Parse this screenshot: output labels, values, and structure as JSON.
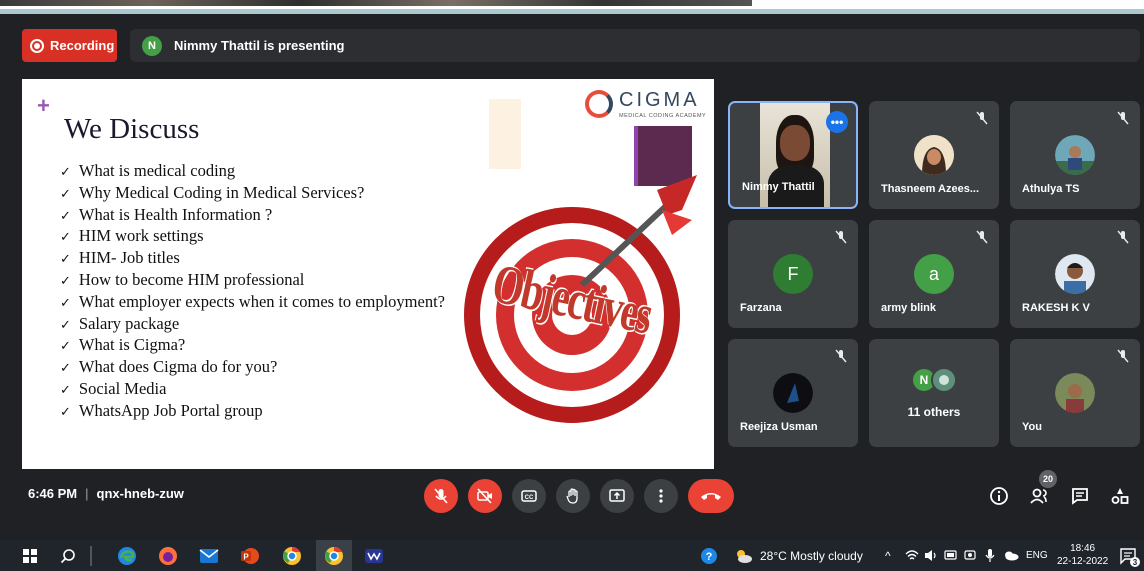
{
  "recording": {
    "label": "Recording"
  },
  "presenting": {
    "avatar_letter": "N",
    "text": "Nimmy Thattil is presenting"
  },
  "slide": {
    "heading": "We Discuss",
    "items": [
      "What is medical coding",
      "Why Medical Coding in Medical Services?",
      "What is Health Information ?",
      "HIM work settings",
      "HIM- Job titles",
      "How to become HIM professional",
      "What employer expects  when it comes to employment?",
      "Salary package",
      "What is Cigma?",
      "What does Cigma do for you?",
      "Social Media",
      "WhatsApp Job Portal group"
    ],
    "logo_name": "CIGMA",
    "logo_sub": "MEDICAL CODING ACADEMY",
    "graphic_text": "Objectives"
  },
  "participants": [
    {
      "name": "Nimmy Thattil",
      "type": "video"
    },
    {
      "name": "Thasneem Azees...",
      "type": "photo"
    },
    {
      "name": "Athulya TS",
      "type": "photo"
    },
    {
      "name": "Farzana",
      "type": "letter",
      "letter": "F",
      "color": "#2e7d32"
    },
    {
      "name": "army blink",
      "type": "letter",
      "letter": "a",
      "color": "#43a047"
    },
    {
      "name": "RAKESH K V",
      "type": "photo"
    },
    {
      "name": "Reejiza Usman",
      "type": "photo"
    },
    {
      "name": "You",
      "type": "photo"
    }
  ],
  "others": {
    "letter": "N",
    "label": "11 others"
  },
  "bottom_bar": {
    "time": "6:46 PM",
    "separator": "|",
    "meeting_code": "qnx-hneb-zuw",
    "people_count": "20"
  },
  "taskbar": {
    "weather": "28°C  Mostly cloudy",
    "language": "ENG",
    "clock_time": "18:46",
    "clock_date": "22-12-2022",
    "notification_count": "3"
  }
}
